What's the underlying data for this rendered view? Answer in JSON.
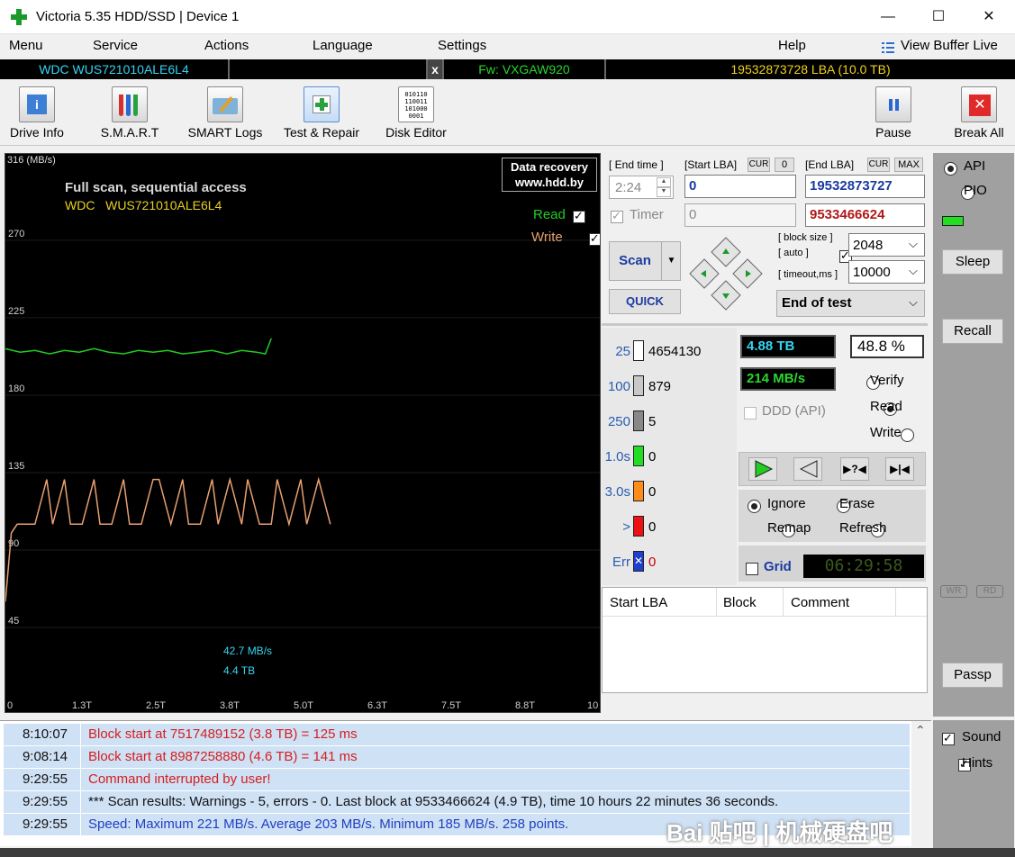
{
  "window": {
    "title": "Victoria 5.35 HDD/SSD | Device 1",
    "minimize": "—",
    "maximize": "☐",
    "close": "✕"
  },
  "menu": {
    "items": [
      "Menu",
      "Service",
      "Actions",
      "Language",
      "Settings",
      "Help"
    ],
    "view_buffer": "View Buffer Live"
  },
  "device": {
    "model": "WDC   WUS721010ALE6L4",
    "eject": "x",
    "firmware": "Fw: VXGAW920",
    "capacity": "19532873728 LBA (10.0 TB)"
  },
  "toolbar": {
    "drive_info": "Drive Info",
    "smart": "S.M.A.R.T",
    "smart_logs": "SMART Logs",
    "test_repair": "Test & Repair",
    "disk_editor": "Disk Editor",
    "disk_editor_bits": [
      "010110",
      "110011",
      "101000",
      "0001"
    ],
    "pause": "Pause",
    "break_all": "Break All"
  },
  "graph": {
    "speed_unit": "316 (MB/s)",
    "badge_line1": "Data recovery",
    "badge_line2": "www.hdd.by",
    "scan_title": "Full scan, sequential access",
    "drive_name": "WDC   WUS721010ALE6L4",
    "read_label": "Read",
    "write_label": "Write",
    "y_ticks": [
      "270",
      "225",
      "180",
      "135",
      "90",
      "45"
    ],
    "x_ticks": [
      "0",
      "1.3T",
      "2.5T",
      "3.8T",
      "5.0T",
      "6.3T",
      "7.5T",
      "8.8T",
      "10"
    ],
    "current_speed": "42.7 MB/s",
    "current_pos": "4.4 TB",
    "colors": {
      "read": "#22cc22",
      "write": "#e8a070",
      "bg": "#000000"
    }
  },
  "chart_data": {
    "type": "line",
    "x_unit": "TB",
    "y_unit": "MB/s",
    "xlim": [
      0,
      10
    ],
    "ylim": [
      0,
      316
    ],
    "series": [
      {
        "name": "Read",
        "x": [
          0.0,
          0.25,
          0.5,
          0.75,
          1.0,
          1.25,
          1.5,
          1.75,
          2.0,
          2.25,
          2.5,
          2.75,
          3.0,
          3.25,
          3.5,
          3.75,
          4.0,
          4.25,
          4.4,
          4.5
        ],
        "y": [
          207,
          205,
          206,
          204,
          206,
          205,
          207,
          205,
          204,
          206,
          205,
          206,
          204,
          205,
          206,
          204,
          206,
          205,
          204,
          213
        ]
      },
      {
        "name": "Write",
        "x": [
          0.0,
          0.1,
          0.2,
          0.5,
          0.7,
          0.8,
          1.0,
          1.1,
          1.3,
          1.5,
          1.6,
          1.8,
          2.0,
          2.1,
          2.3,
          2.5,
          2.6,
          2.8,
          3.0,
          3.1,
          3.3,
          3.5,
          3.6,
          3.8,
          4.0,
          4.1,
          4.3,
          4.5,
          4.6,
          4.8,
          5.0,
          5.1,
          5.3,
          5.5
        ],
        "y": [
          60,
          100,
          105,
          105,
          131,
          105,
          131,
          105,
          105,
          131,
          105,
          105,
          131,
          105,
          105,
          131,
          131,
          105,
          131,
          105,
          105,
          131,
          105,
          131,
          105,
          131,
          105,
          105,
          131,
          105,
          131,
          105,
          131,
          105
        ]
      }
    ]
  },
  "controls": {
    "end_time_label": "[ End time ]",
    "end_time_value": "2:24",
    "start_lba_label": "[Start LBA]",
    "cur_label": "CUR",
    "zero_label": "0",
    "start_lba_value": "0",
    "end_lba_label": "[End LBA]",
    "max_label": "MAX",
    "end_lba_value": "19532873727",
    "timer_label": "Timer",
    "timer_value": "0",
    "current_lba_value": "9533466624",
    "scan_label": "Scan",
    "quick_label": "QUICK",
    "block_size_label": "[ block size ]",
    "auto_label": "[ auto ]",
    "timeout_label": "[ timeout,ms ]",
    "block_size_value": "2048",
    "timeout_value": "10000",
    "end_action": "End of test",
    "dropdown_arrow": "⌵",
    "spin_up": "▲",
    "spin_down": "▼"
  },
  "stats": {
    "rows": [
      {
        "label": "25",
        "count": "4654130",
        "color": "#ffffff",
        "label_color": "#2b5cb0",
        "count_color": "#000000"
      },
      {
        "label": "100",
        "count": "879",
        "color": "#c8c8c8",
        "label_color": "#2b5cb0",
        "count_color": "#000000"
      },
      {
        "label": "250",
        "count": "5",
        "color": "#888888",
        "label_color": "#2b5cb0",
        "count_color": "#000000"
      },
      {
        "label": "1.0s",
        "count": "0",
        "color": "#22dd22",
        "label_color": "#2b5cb0",
        "count_color": "#000000"
      },
      {
        "label": "3.0s",
        "count": "0",
        "color": "#ff8c1a",
        "label_color": "#2b5cb0",
        "count_color": "#000000"
      },
      {
        "label": ">",
        "count": "0",
        "color": "#ee1111",
        "label_color": "#2b5cb0",
        "count_color": "#000000"
      },
      {
        "label": "Err",
        "count": "0",
        "color": "#1f3fd0",
        "label_color": "#2b5cb0",
        "count_color": "#cc0000"
      }
    ],
    "err_mark": "✕"
  },
  "progress": {
    "size_done": "4.88 TB",
    "percent": "48.8  %",
    "speed": "214 MB/s",
    "ddd_label": "DDD (API)",
    "verify": "Verify",
    "read": "Read",
    "write": "Write"
  },
  "actions": {
    "ignore": "Ignore",
    "erase": "Erase",
    "remap": "Remap",
    "refresh": "Refresh",
    "grid": "Grid",
    "clock": "06:29:58"
  },
  "table": {
    "columns": [
      "Start LBA",
      "Block",
      "Comment"
    ]
  },
  "side": {
    "api": "API",
    "pio": "PIO",
    "sleep": "Sleep",
    "recall": "Recall",
    "wr": "WR",
    "rd": "RD",
    "passp": "Passp",
    "sound": "Sound",
    "hints": "Hints"
  },
  "log": {
    "rows": [
      {
        "time": "8:10:07",
        "msg": "Block start at 7517489152 (3.8 TB)  = 125 ms",
        "color": "#d42020"
      },
      {
        "time": "9:08:14",
        "msg": "Block start at 8987258880 (4.6 TB)  = 141 ms",
        "color": "#d42020"
      },
      {
        "time": "9:29:55",
        "msg": "Command interrupted by user!",
        "color": "#d42020"
      },
      {
        "time": "9:29:55",
        "msg": "*** Scan results: Warnings - 5, errors - 0. Last block at 9533466624 (4.9 TB), time 10 hours 22 minutes 36 seconds.",
        "color": "#111111"
      },
      {
        "time": "9:29:55",
        "msg": "Speed: Maximum 221 MB/s. Average 203 MB/s. Minimum 185 MB/s. 258 points.",
        "color": "#2040c0"
      }
    ],
    "watermark": "Bai 贴吧 | 机械硬盘吧",
    "scroll_up": "⌃"
  }
}
